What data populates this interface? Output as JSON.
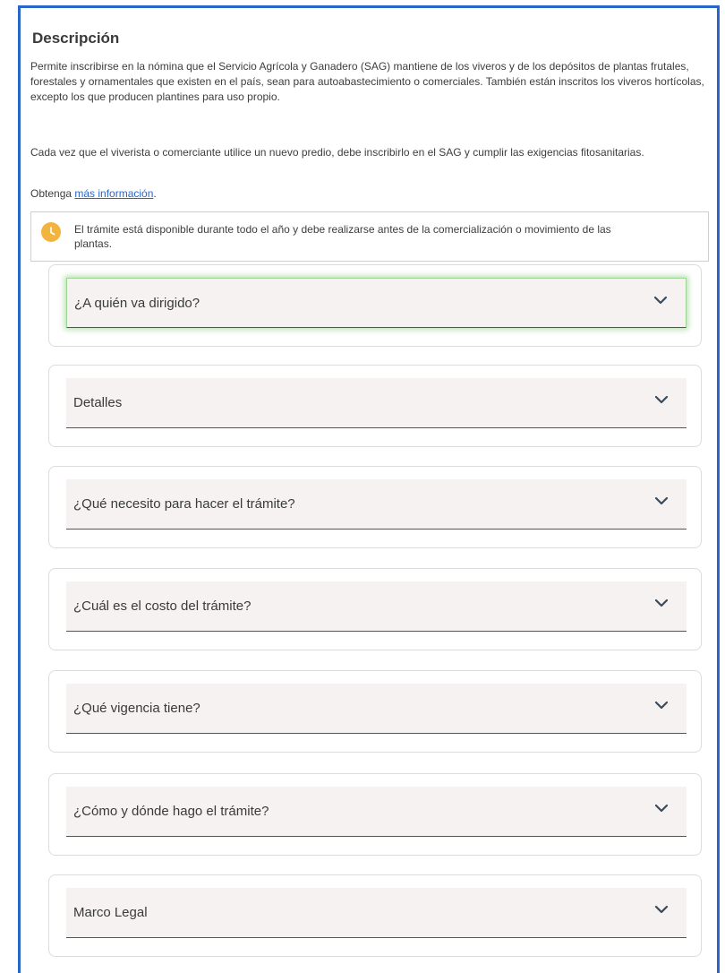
{
  "description": {
    "title": "Descripción",
    "paragraph1": "Permite inscribirse en la nómina que el Servicio Agrícola y Ganadero (SAG) mantiene de los viveros y de los depósitos de plantas frutales, forestales y ornamentales que existen en el país, sean para autoabastecimiento o comerciales. También están inscritos los viveros hortícolas, excepto los que producen plantines para uso propio.",
    "paragraph2": "Cada vez que el viverista o comerciante utilice un nuevo predio, debe inscribirlo en el SAG y cumplir las exigencias fitosanitarias.",
    "more_info_prefix": "Obtenga ",
    "more_info_link": "más información",
    "more_info_suffix": "."
  },
  "notice": {
    "icon": "clock-icon",
    "icon_color": "#f3b43f",
    "text": "El trámite está disponible durante todo el año y debe realizarse antes de la comercialización o movimiento de las plantas."
  },
  "accordion": [
    {
      "label": "¿A quién va dirigido?",
      "focused": true
    },
    {
      "label": "Detalles",
      "focused": false
    },
    {
      "label": "¿Qué necesito para hacer el trámite?",
      "focused": false
    },
    {
      "label": "¿Cuál es el costo del trámite?",
      "focused": false
    },
    {
      "label": "¿Qué vigencia tiene?",
      "focused": false
    },
    {
      "label": "¿Cómo y dónde hago el trámite?",
      "focused": false
    },
    {
      "label": "Marco Legal",
      "focused": false
    }
  ],
  "colors": {
    "frame_border": "#2a66c9",
    "link": "#2a66c9",
    "header_bg": "#f6f2f2",
    "focus_glow": "#9fd497"
  }
}
